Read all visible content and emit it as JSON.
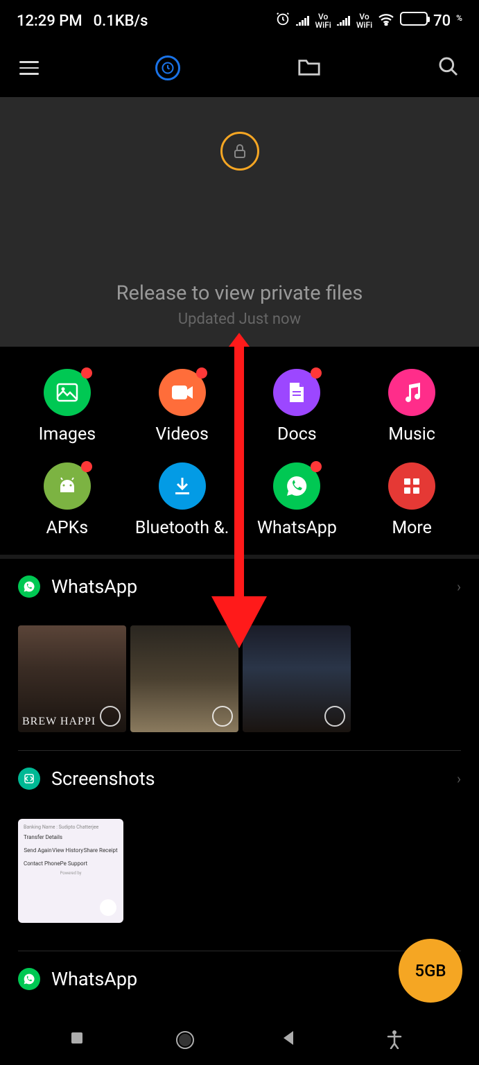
{
  "status": {
    "time": "12:29 PM",
    "speed": "0.1KB/s",
    "vowifi": "Vo\nWiFi",
    "battery_pct": "70",
    "battery_suffix": "%"
  },
  "private": {
    "title": "Release to view private files",
    "subtitle": "Updated Just now"
  },
  "categories": [
    {
      "label": "Images"
    },
    {
      "label": "Videos"
    },
    {
      "label": "Docs"
    },
    {
      "label": "Music"
    },
    {
      "label": "APKs"
    },
    {
      "label": "Bluetooth &."
    },
    {
      "label": "WhatsApp"
    },
    {
      "label": "More"
    }
  ],
  "sections": {
    "whatsapp": {
      "title": "WhatsApp"
    },
    "screenshots": {
      "title": "Screenshots"
    },
    "whatsapp2": {
      "title": "WhatsApp"
    }
  },
  "screenshot_preview": {
    "line1": "Banking Name : Sudipto Chatterjee",
    "line2": "Transfer Details",
    "b1": "Send Again",
    "b2": "View History",
    "b3": "Share Receipt",
    "line3": "Contact PhonePe Support",
    "line4": "Powered by"
  },
  "fab": {
    "label": "5GB"
  }
}
